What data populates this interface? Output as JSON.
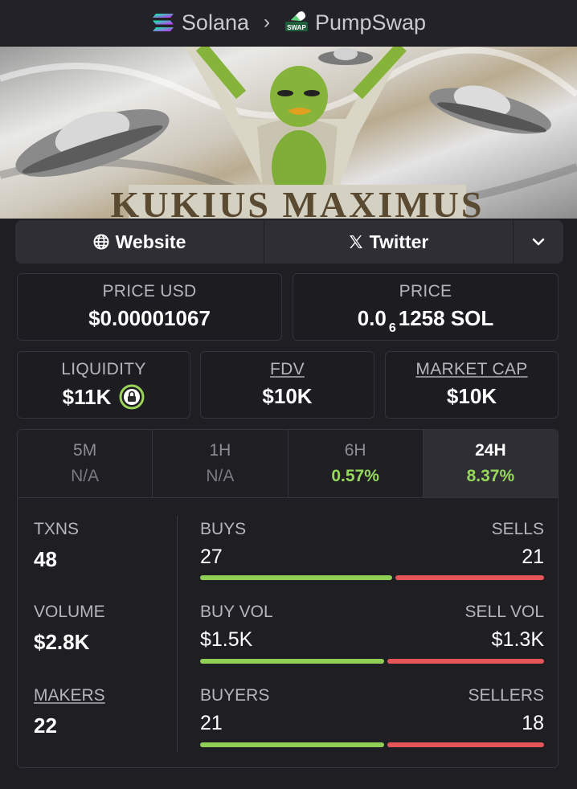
{
  "breadcrumb": {
    "chain": "Solana",
    "dex": "PumpSwap",
    "dex_badge": "SWAP"
  },
  "banner": {
    "title": "KUKIUS MAXIMUS"
  },
  "links": {
    "website": "Website",
    "twitter": "Twitter"
  },
  "price_usd": {
    "label": "PRICE USD",
    "value": "$0.00001067"
  },
  "price_native": {
    "label": "PRICE",
    "prefix": "0.0",
    "zeros": "6",
    "digits": "1258",
    "unit": "SOL"
  },
  "liquidity": {
    "label": "LIQUIDITY",
    "value": "$11K"
  },
  "fdv": {
    "label": "FDV",
    "value": "$10K"
  },
  "market_cap": {
    "label": "MARKET CAP",
    "value": "$10K"
  },
  "timeframes": [
    {
      "label": "5M",
      "value": "N/A"
    },
    {
      "label": "1H",
      "value": "N/A"
    },
    {
      "label": "6H",
      "value": "0.57%"
    },
    {
      "label": "24H",
      "value": "8.37%",
      "active": true
    }
  ],
  "stats": {
    "txns": {
      "label": "TXNS",
      "value": "48"
    },
    "volume": {
      "label": "VOLUME",
      "value": "$2.8K"
    },
    "makers": {
      "label": "MAKERS",
      "value": "22"
    },
    "buys": {
      "label": "BUYS",
      "value": "27"
    },
    "sells": {
      "label": "SELLS",
      "value": "21"
    },
    "buy_vol": {
      "label": "BUY VOL",
      "value": "$1.5K"
    },
    "sell_vol": {
      "label": "SELL VOL",
      "value": "$1.3K"
    },
    "buyers": {
      "label": "BUYERS",
      "value": "21"
    },
    "sellers": {
      "label": "SELLERS",
      "value": "18"
    }
  },
  "bars": {
    "txns_buy_fraction": 0.5625,
    "volume_buy_fraction": 0.54,
    "makers_buy_fraction": 0.54
  },
  "colors": {
    "buy": "#8fcf55",
    "sell": "#e4555a",
    "positive": "#96d95a",
    "lock": "#9bd45b"
  },
  "icons": [
    "solana-icon",
    "chevron-right-icon",
    "pumpswap-icon",
    "globe-icon",
    "x-icon",
    "chevron-down-icon",
    "lock-icon"
  ]
}
